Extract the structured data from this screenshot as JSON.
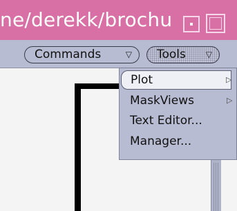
{
  "window": {
    "title": "ne/derekk/brochu",
    "minimize_icon": "minimize-icon",
    "maximize_icon": "maximize-icon"
  },
  "toolbar": {
    "commands_label": "Commands",
    "tools_label": "Tools",
    "dropdown_icon": "triangle-down-icon"
  },
  "menu": {
    "items": [
      {
        "label": "Plot",
        "has_submenu": true
      },
      {
        "label": "MaskViews",
        "has_submenu": true
      },
      {
        "label": "Text Editor...",
        "has_submenu": false
      },
      {
        "label": "Manager...",
        "has_submenu": false
      }
    ],
    "submenu_icon": "triangle-right-icon"
  },
  "colors": {
    "titlebar": "#d870a5",
    "toolbar": "#b8bcd2",
    "canvas": "#f4f4f4",
    "menu": "#b8bcd2"
  }
}
